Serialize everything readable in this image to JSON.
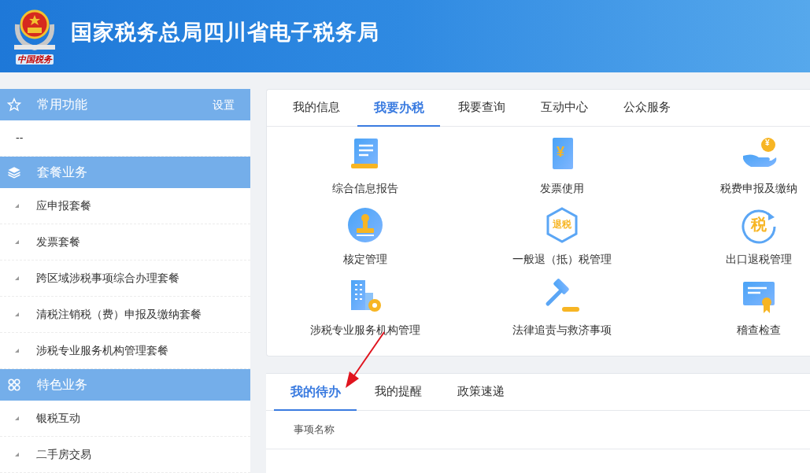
{
  "header": {
    "title": "国家税务总局四川省电子税务局",
    "emblem_caption": "中国税务"
  },
  "sidebar": {
    "groups": [
      {
        "kind": "star",
        "title": "常用功能",
        "action": "设置",
        "items": [
          {
            "label": "--",
            "bullet": false
          }
        ]
      },
      {
        "kind": "layers",
        "title": "套餐业务",
        "items": [
          {
            "label": "应申报套餐",
            "bullet": true
          },
          {
            "label": "发票套餐",
            "bullet": true
          },
          {
            "label": "跨区域涉税事项综合办理套餐",
            "bullet": true
          },
          {
            "label": "清税注销税（费）申报及缴纳套餐",
            "bullet": true
          },
          {
            "label": "涉税专业服务机构管理套餐",
            "bullet": true
          }
        ]
      },
      {
        "kind": "grid",
        "title": "特色业务",
        "items": [
          {
            "label": "银税互动",
            "bullet": true
          },
          {
            "label": "二手房交易",
            "bullet": true
          }
        ]
      }
    ]
  },
  "main_tabs": [
    {
      "label": "我的信息",
      "selected": false
    },
    {
      "label": "我要办税",
      "selected": true
    },
    {
      "label": "我要查询",
      "selected": false
    },
    {
      "label": "互动中心",
      "selected": false
    },
    {
      "label": "公众服务",
      "selected": false
    }
  ],
  "services": [
    {
      "kind": "report",
      "label": "综合信息报告"
    },
    {
      "kind": "invoice",
      "label": "发票使用",
      "badge": "¥"
    },
    {
      "kind": "payment",
      "label": "税费申报及缴纳",
      "badge": "¥"
    },
    {
      "kind": "stamp",
      "label": "核定管理"
    },
    {
      "kind": "refund",
      "label": "一般退（抵）税管理",
      "badge": "退税"
    },
    {
      "kind": "export",
      "label": "出口退税管理",
      "badge": "税"
    },
    {
      "kind": "building",
      "label": "涉税专业服务机构管理"
    },
    {
      "kind": "gavel",
      "label": "法律追责与救济事项"
    },
    {
      "kind": "certificate",
      "label": "稽查检查"
    }
  ],
  "todo_tabs": [
    {
      "label": "我的待办",
      "selected": true
    },
    {
      "label": "我的提醒",
      "selected": false
    },
    {
      "label": "政策速递",
      "selected": false
    }
  ],
  "todo_table": {
    "columns": [
      "事项名称"
    ]
  }
}
